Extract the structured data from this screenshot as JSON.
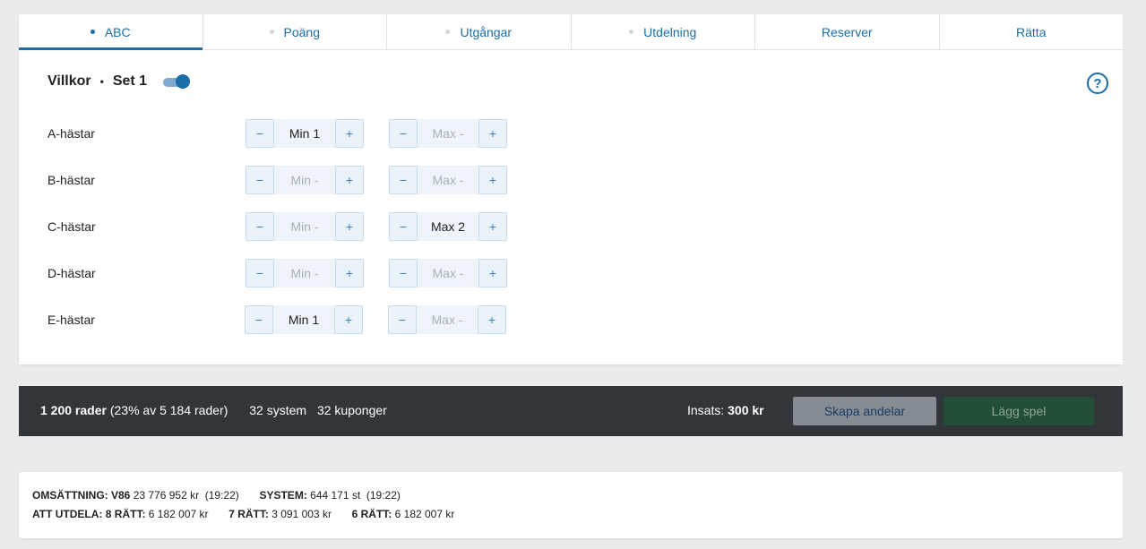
{
  "tabs": [
    {
      "label": "ABC",
      "dot": true,
      "active": true
    },
    {
      "label": "Poäng",
      "dot": true
    },
    {
      "label": "Utgångar",
      "dot": true
    },
    {
      "label": "Utdelning",
      "dot": true
    },
    {
      "label": "Reserver",
      "dot": false
    },
    {
      "label": "Rätta",
      "dot": false
    }
  ],
  "villkor": {
    "title": "Villkor",
    "separator": "•",
    "set_label": "Set 1",
    "toggle_on": true
  },
  "help_icon": "?",
  "stepper_glyphs": {
    "minus": "−",
    "plus": "+"
  },
  "rows": [
    {
      "label": "A-hästar",
      "min": "Min 1",
      "max": "Max -"
    },
    {
      "label": "B-hästar",
      "min": "Min -",
      "max": "Max -"
    },
    {
      "label": "C-hästar",
      "min": "Min -",
      "max": "Max 2"
    },
    {
      "label": "D-hästar",
      "min": "Min -",
      "max": "Max -"
    },
    {
      "label": "E-hästar",
      "min": "Min 1",
      "max": "Max -"
    }
  ],
  "summary": {
    "rows_bold": "1 200 rader",
    "rows_rest": "(23% av 5 184 rader)",
    "system": "32 system",
    "kuponger": "32 kuponger",
    "insats_label": "Insats:",
    "insats_value": "300 kr",
    "skapa_andelar": "Skapa andelar",
    "lagg_spel": "Lägg spel"
  },
  "info": {
    "omsattning_label": "OMSÄTTNING: V86",
    "omsattning_value": "23 776 952 kr",
    "omsattning_time": "(19:22)",
    "system_label": "SYSTEM:",
    "system_value": "644 171 st",
    "system_time": "(19:22)",
    "att_utdela_label": "ATT UTDELA:",
    "r8_label": "8 RÄTT:",
    "r8_value": "6 182 007 kr",
    "r7_label": "7 RÄTT:",
    "r7_value": "3 091 003 kr",
    "r6_label": "6 RÄTT:",
    "r6_value": "6 182 007 kr"
  },
  "colors": {
    "accent": "#1a6ea8",
    "bar_bg": "#32353a",
    "page_bg": "#ebebeb"
  }
}
